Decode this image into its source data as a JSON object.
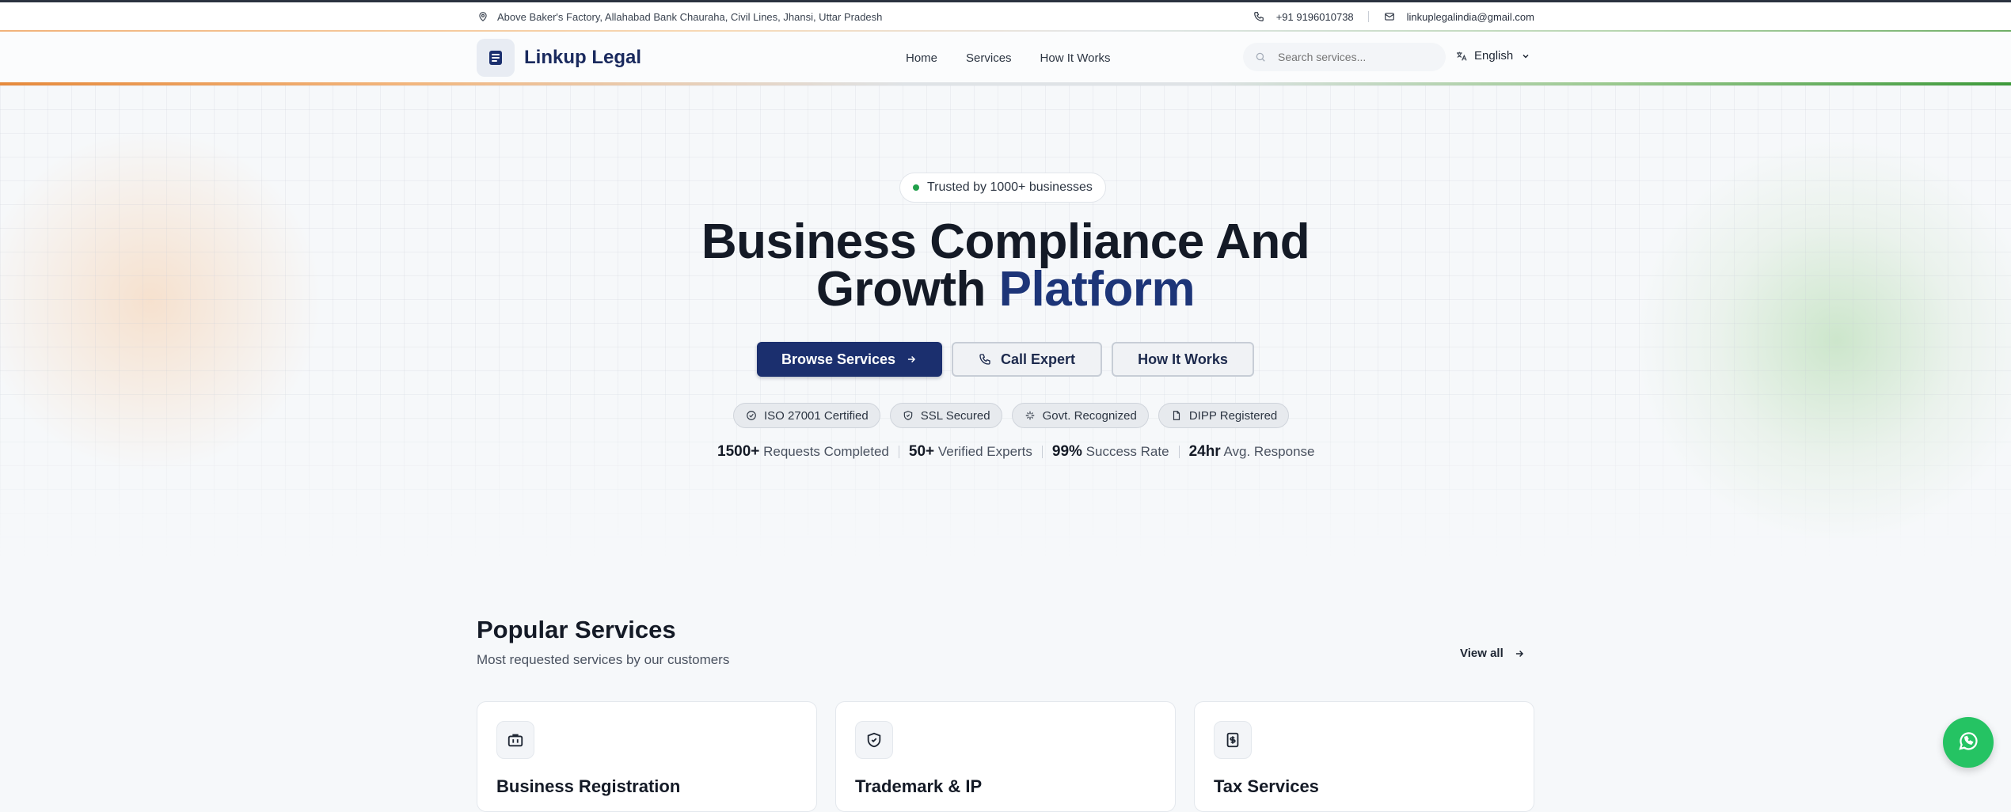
{
  "topbar": {
    "address": "Above Baker's Factory, Allahabad Bank Chauraha, Civil Lines, Jhansi, Uttar Pradesh",
    "phone": "+91 9196010738",
    "email": "linkuplegalindia@gmail.com"
  },
  "header": {
    "brand": "Linkup Legal",
    "nav": [
      "Home",
      "Services",
      "How It Works"
    ],
    "search_placeholder": "Search services...",
    "language": "English"
  },
  "hero": {
    "badge": "Trusted by 1000+ businesses",
    "title_line1": "Business Compliance And",
    "title_line2_plain": "Growth ",
    "title_line2_accent": "Platform",
    "buttons": {
      "browse": "Browse Services",
      "call": "Call Expert",
      "how": "How It Works"
    },
    "certifications": [
      "ISO 27001 Certified",
      "SSL Secured",
      "Govt. Recognized",
      "DIPP Registered"
    ],
    "stats": [
      {
        "value": "1500+",
        "label": "Requests Completed"
      },
      {
        "value": "50+",
        "label": "Verified Experts"
      },
      {
        "value": "99%",
        "label": "Success Rate"
      },
      {
        "value": "24hr",
        "label": "Avg. Response"
      }
    ]
  },
  "popular": {
    "title": "Popular Services",
    "subtitle": "Most requested services by our customers",
    "view_all": "View all",
    "cards": [
      {
        "icon": "briefcase-icon",
        "title": "Business Registration"
      },
      {
        "icon": "shield-check-icon",
        "title": "Trademark & IP"
      },
      {
        "icon": "receipt-icon",
        "title": "Tax Services"
      }
    ]
  },
  "colors": {
    "brand": "#1b2f6e",
    "accent": "#1d3578",
    "saffron": "#e68a3c",
    "green": "#3d9a3a",
    "whatsapp": "#25c363"
  }
}
